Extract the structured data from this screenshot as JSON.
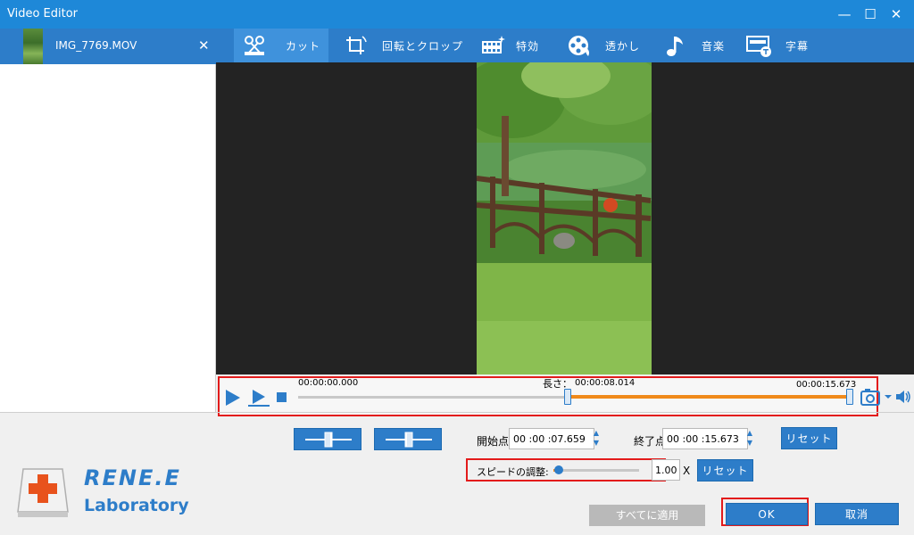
{
  "window": {
    "title": "Video Editor",
    "minimize": "—",
    "maximize": "☐",
    "close": "✕"
  },
  "file": {
    "name": "IMG_7769.MOV",
    "close": "✕"
  },
  "tabs": [
    {
      "label": "カット"
    },
    {
      "label": "回転とクロップ"
    },
    {
      "label": "特効"
    },
    {
      "label": "透かし"
    },
    {
      "label": "音楽"
    },
    {
      "label": "字幕"
    }
  ],
  "timeline": {
    "start_time": "00:00:00.000",
    "length_label": "長さ：",
    "length_value": "00:00:08.014",
    "end_time": "00:00:15.673",
    "selection_start_fraction": 0.486,
    "selection_end_fraction": 1.0
  },
  "controls": {
    "start_label": "開始点",
    "start_value": "00 :00 :07.659",
    "end_label": "終了点",
    "end_value": "00 :00 :15.673",
    "reset_label": "リセット",
    "speed_label": "スピードの調整:",
    "speed_value": "1.00",
    "speed_unit": "X",
    "speed_fraction": 0.06,
    "apply_all_label": "すべてに適用",
    "ok_label": "OK",
    "cancel_label": "取消"
  },
  "logo": {
    "line1": "RENE.E",
    "line2": "Laboratory"
  },
  "colors": {
    "accent": "#2d7dc9",
    "highlight": "#e31b1b",
    "range": "#f08a1b"
  }
}
